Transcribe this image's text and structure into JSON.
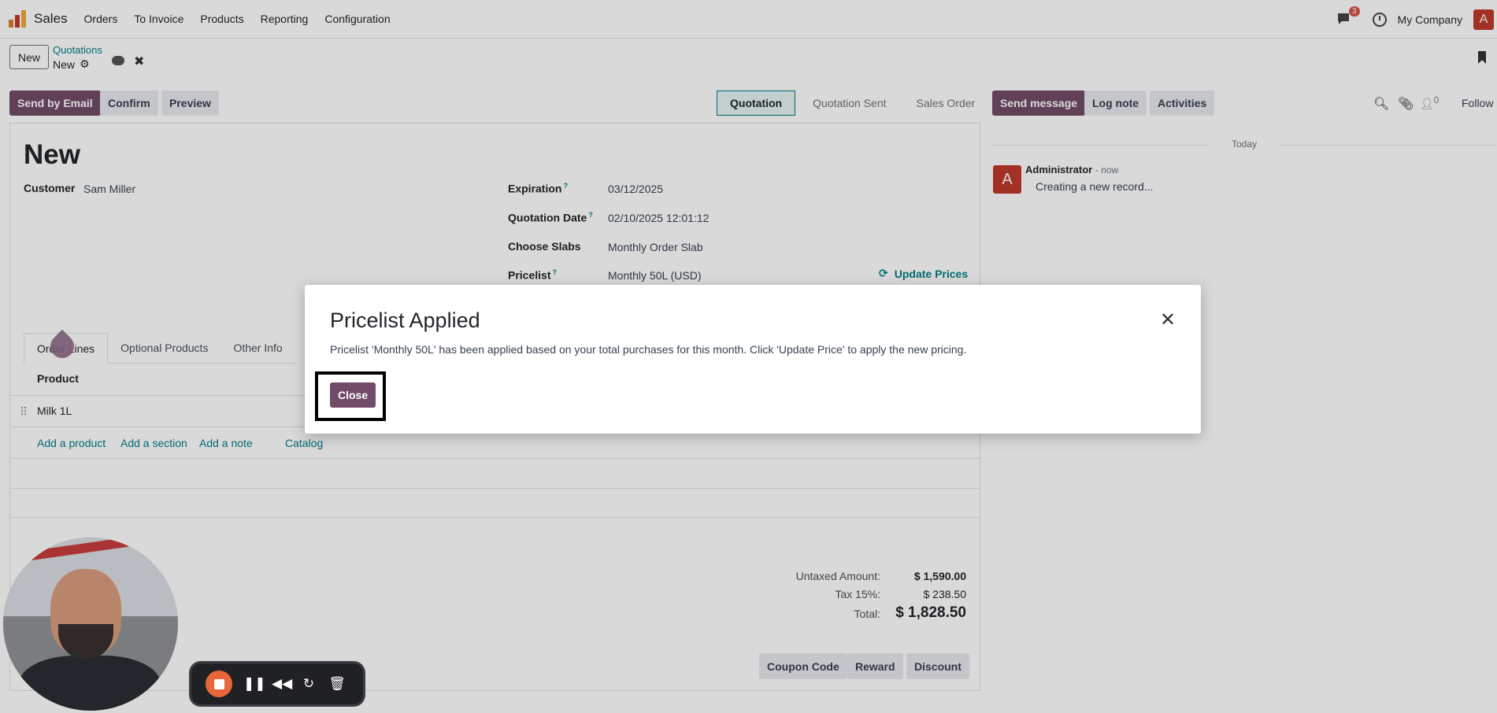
{
  "topnav": {
    "app_name": "Sales",
    "menu": [
      "Orders",
      "To Invoice",
      "Products",
      "Reporting",
      "Configuration"
    ],
    "chat_badge": "3",
    "company": "My Company",
    "avatar_letter": "A"
  },
  "control": {
    "new_button": "New",
    "breadcrumb_parent": "Quotations",
    "breadcrumb_current": "New"
  },
  "actions": {
    "send_email": "Send by Email",
    "confirm": "Confirm",
    "preview": "Preview"
  },
  "statusbar": [
    "Quotation",
    "Quotation Sent",
    "Sales Order"
  ],
  "form": {
    "title": "New",
    "customer_label": "Customer",
    "customer_value": "Sam Miller",
    "expiration_label": "Expiration",
    "expiration_value": "03/12/2025",
    "quotation_date_label": "Quotation Date",
    "quotation_date_value": "02/10/2025 12:01:12",
    "slabs_label": "Choose Slabs",
    "slabs_value": "Monthly Order Slab",
    "pricelist_label": "Pricelist",
    "pricelist_value": "Monthly 50L (USD)",
    "update_prices": "Update Prices",
    "help_mark": "?"
  },
  "tabs": [
    "Order Lines",
    "Optional Products",
    "Other Info"
  ],
  "table": {
    "col_product": "Product",
    "row_product": "Milk 1L",
    "add_product": "Add a product",
    "add_section": "Add a section",
    "add_note": "Add a note",
    "catalog": "Catalog"
  },
  "promo": {
    "coupon": "Coupon Code",
    "reward": "Reward",
    "discount": "Discount"
  },
  "totals": {
    "untaxed_label": "Untaxed Amount:",
    "untaxed_value": "$ 1,590.00",
    "tax_label": "Tax 15%:",
    "tax_value": "$ 238.50",
    "total_label": "Total:",
    "total_value": "$ 1,828.50"
  },
  "chatter": {
    "send_message": "Send message",
    "log_note": "Log note",
    "activities": "Activities",
    "followers_count": "0",
    "follow": "Follow",
    "today": "Today",
    "avatar_letter": "A",
    "author": "Administrator",
    "time": "- now",
    "body": "Creating a new record..."
  },
  "modal": {
    "title": "Pricelist Applied",
    "body": "Pricelist 'Monthly 50L' has been applied based on your total purchases for this month. Click 'Update Price' to apply the new pricing.",
    "close_button": "Close"
  },
  "colors": {
    "primary": "#714b67",
    "link": "#017e84",
    "avatar": "#c0392b",
    "recorder_stop": "#e8663a"
  }
}
